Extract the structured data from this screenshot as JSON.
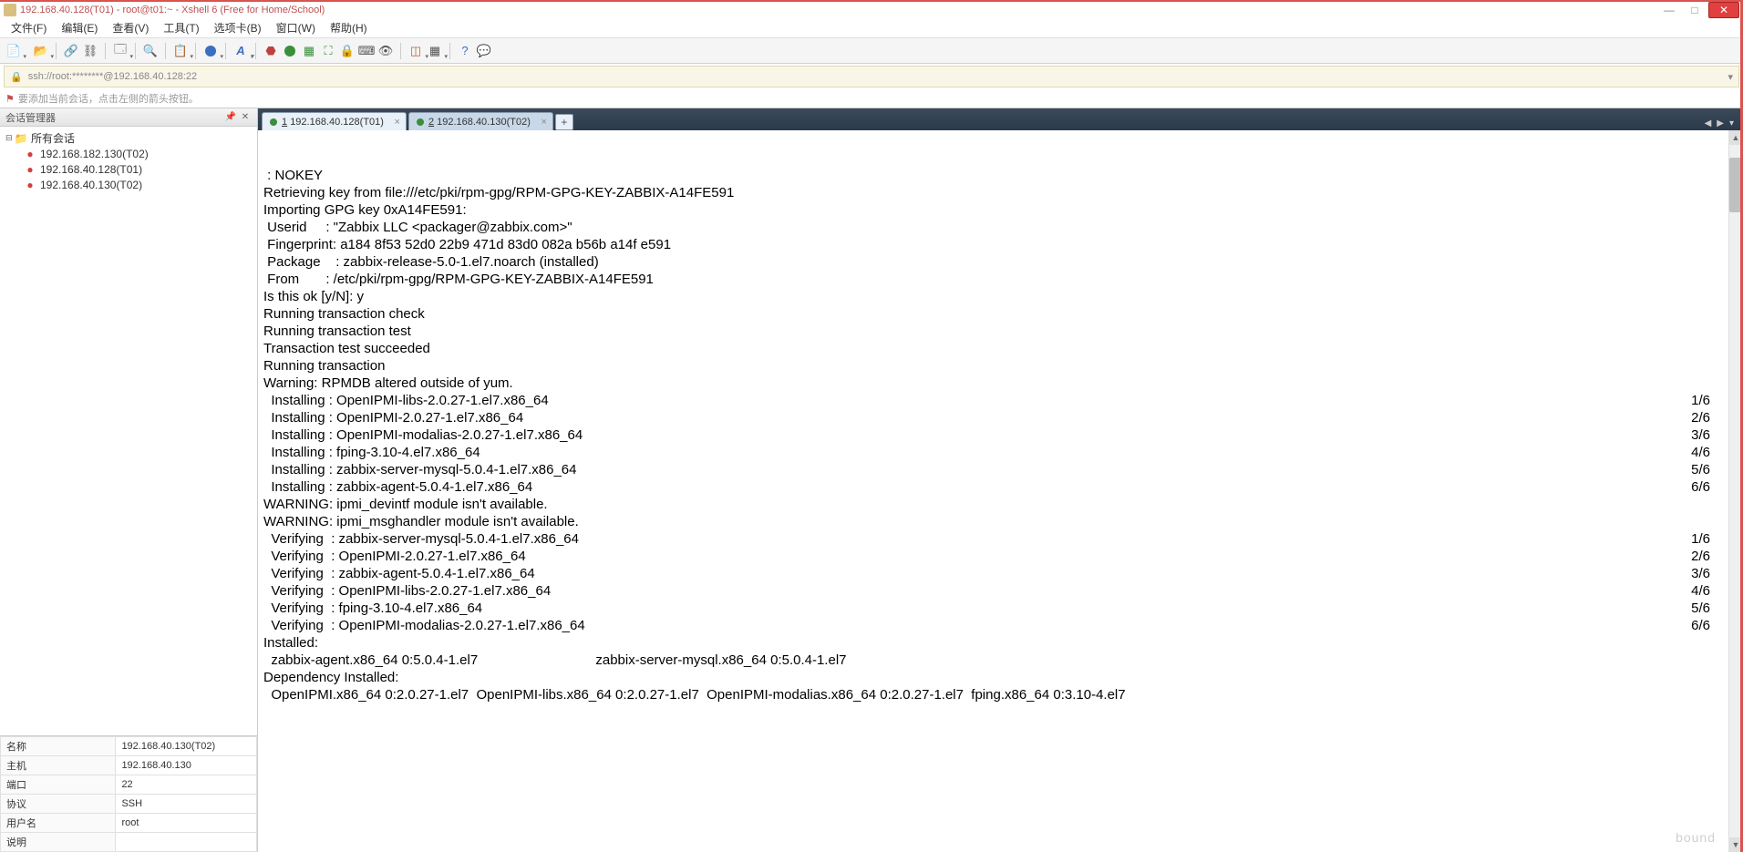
{
  "titlebar": {
    "text": "192.168.40.128(T01) - root@t01:~ - Xshell 6 (Free for Home/School)"
  },
  "window_controls": {
    "min": "—",
    "max": "□",
    "close": "✕"
  },
  "menubar": [
    "文件(F)",
    "编辑(E)",
    "查看(V)",
    "工具(T)",
    "选项卡(B)",
    "窗口(W)",
    "帮助(H)"
  ],
  "addressbar": {
    "text": "ssh://root:********@192.168.40.128:22"
  },
  "hint": "要添加当前会话，点击左侧的箭头按钮。",
  "left_panel": {
    "title": "会话管理器",
    "root": "所有会话",
    "sessions": [
      "192.168.182.130(T02)",
      "192.168.40.128(T01)",
      "192.168.40.130(T02)"
    ]
  },
  "properties": [
    [
      "名称",
      "192.168.40.130(T02)"
    ],
    [
      "主机",
      "192.168.40.130"
    ],
    [
      "端口",
      "22"
    ],
    [
      "协议",
      "SSH"
    ],
    [
      "用户名",
      "root"
    ],
    [
      "说明",
      ""
    ]
  ],
  "tabs": [
    {
      "num": "1",
      "label": "192.168.40.128(T01)",
      "active": true
    },
    {
      "num": "2",
      "label": "192.168.40.130(T02)",
      "active": false
    }
  ],
  "newtab": "+",
  "terminal": {
    "lines": [
      " : NOKEY",
      "Retrieving key from file:///etc/pki/rpm-gpg/RPM-GPG-KEY-ZABBIX-A14FE591",
      "Importing GPG key 0xA14FE591:",
      " Userid     : \"Zabbix LLC <packager@zabbix.com>\"",
      " Fingerprint: a184 8f53 52d0 22b9 471d 83d0 082a b56b a14f e591",
      " Package    : zabbix-release-5.0-1.el7.noarch (installed)",
      " From       : /etc/pki/rpm-gpg/RPM-GPG-KEY-ZABBIX-A14FE591",
      "Is this ok [y/N]: y",
      "Running transaction check",
      "Running transaction test",
      "Transaction test succeeded",
      "Running transaction",
      "Warning: RPMDB altered outside of yum."
    ],
    "install_lines": [
      {
        "l": "  Installing : OpenIPMI-libs-2.0.27-1.el7.x86_64",
        "r": "1/6"
      },
      {
        "l": "  Installing : OpenIPMI-2.0.27-1.el7.x86_64",
        "r": "2/6"
      },
      {
        "l": "  Installing : OpenIPMI-modalias-2.0.27-1.el7.x86_64",
        "r": "3/6"
      },
      {
        "l": "  Installing : fping-3.10-4.el7.x86_64",
        "r": "4/6"
      },
      {
        "l": "  Installing : zabbix-server-mysql-5.0.4-1.el7.x86_64",
        "r": "5/6"
      },
      {
        "l": "  Installing : zabbix-agent-5.0.4-1.el7.x86_64",
        "r": "6/6"
      }
    ],
    "warn_lines": [
      "WARNING: ipmi_devintf module isn't available.",
      "WARNING: ipmi_msghandler module isn't available."
    ],
    "verify_lines": [
      {
        "l": "  Verifying  : zabbix-server-mysql-5.0.4-1.el7.x86_64",
        "r": "1/6"
      },
      {
        "l": "  Verifying  : OpenIPMI-2.0.27-1.el7.x86_64",
        "r": "2/6"
      },
      {
        "l": "  Verifying  : zabbix-agent-5.0.4-1.el7.x86_64",
        "r": "3/6"
      },
      {
        "l": "  Verifying  : OpenIPMI-libs-2.0.27-1.el7.x86_64",
        "r": "4/6"
      },
      {
        "l": "  Verifying  : fping-3.10-4.el7.x86_64",
        "r": "5/6"
      },
      {
        "l": "  Verifying  : OpenIPMI-modalias-2.0.27-1.el7.x86_64",
        "r": "6/6"
      }
    ],
    "tail_lines": [
      "",
      "Installed:",
      "  zabbix-agent.x86_64 0:5.0.4-1.el7                               zabbix-server-mysql.x86_64 0:5.0.4-1.el7",
      "",
      "Dependency Installed:",
      "  OpenIPMI.x86_64 0:2.0.27-1.el7  OpenIPMI-libs.x86_64 0:2.0.27-1.el7  OpenIPMI-modalias.x86_64 0:2.0.27-1.el7  fping.x86_64 0:3.10-4.el7"
    ]
  },
  "watermark": "bound"
}
